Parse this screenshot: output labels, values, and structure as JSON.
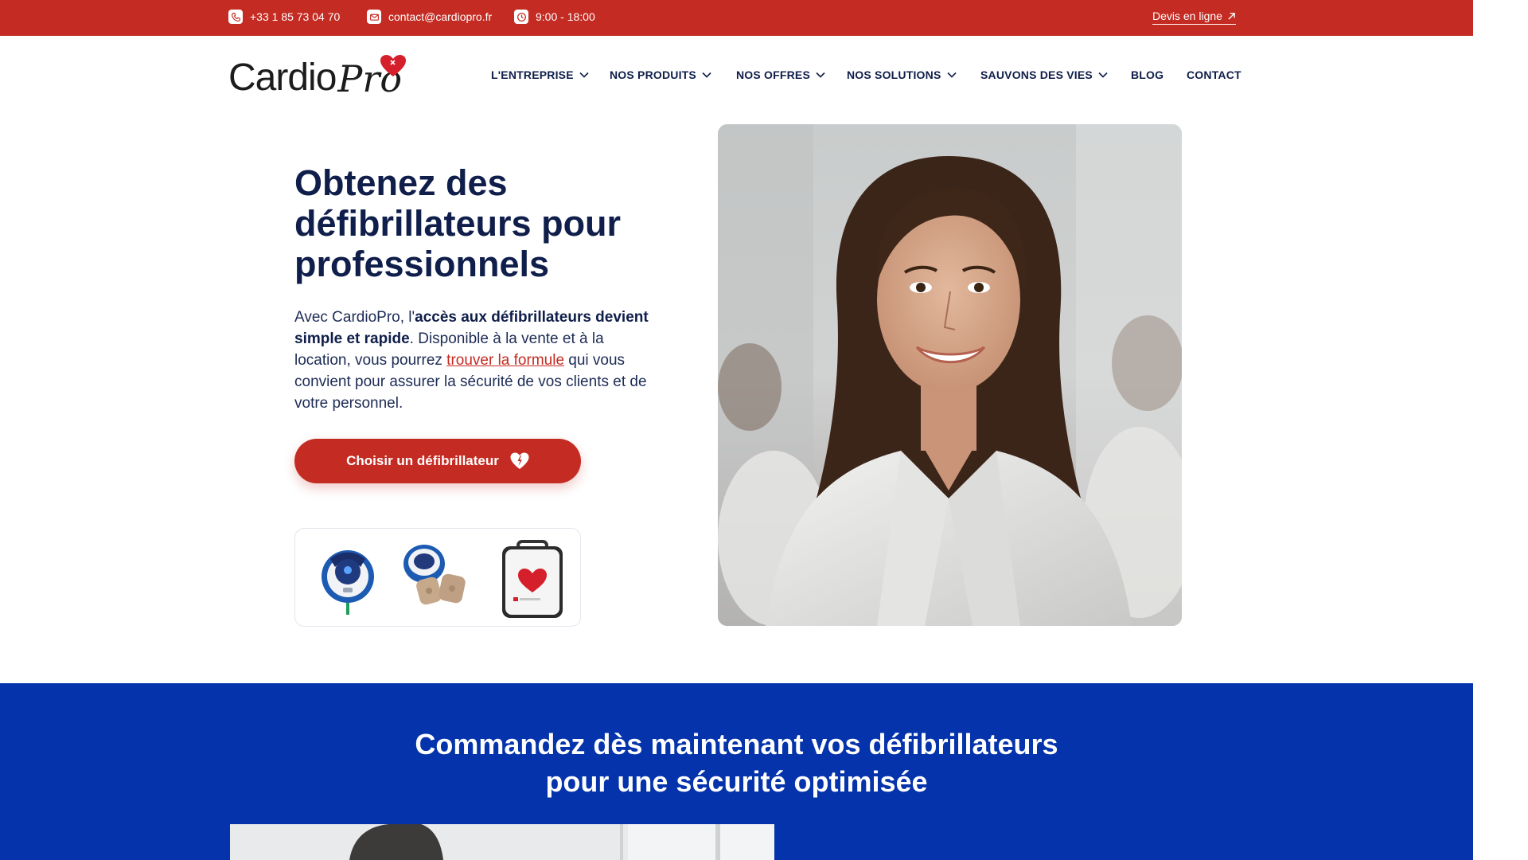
{
  "topbar": {
    "phone": "+33 1 85 73 04 70",
    "email": "contact@cardiopro.fr",
    "hours": "9:00 - 18:00",
    "quote_link": "Devis en ligne",
    "bg_color": "#c42b22"
  },
  "brand": {
    "name_part1": "Cardio",
    "name_part2": "Pro",
    "accent_color": "#c42b22"
  },
  "nav": {
    "items": [
      {
        "label": "L'ENTREPRISE",
        "has_dropdown": true
      },
      {
        "label": "NOS PRODUITS",
        "has_dropdown": true
      },
      {
        "label": "NOS OFFRES",
        "has_dropdown": true
      },
      {
        "label": "NOS SOLUTIONS",
        "has_dropdown": true
      },
      {
        "label": "SAUVONS DES VIES",
        "has_dropdown": true
      },
      {
        "label": "BLOG",
        "has_dropdown": false
      },
      {
        "label": "CONTACT",
        "has_dropdown": false
      }
    ]
  },
  "hero": {
    "title": "Obtenez des défibrillateurs pour professionnels",
    "text_1": "Avec CardioPro, l'",
    "text_bold": "accès aux défibrillateurs devient simple et rapide",
    "text_2": ". Disponible à la vente et à la location, vous pourrez ",
    "text_link": "trouver la formule",
    "text_3": " qui vous convient pour assurer la sécurité de vos clients et de votre personnel.",
    "cta_label": "Choisir un défibrillateur",
    "image_alt": "professional-woman-photo"
  },
  "section2": {
    "title_line1": "Commandez dès maintenant vos défibrillateurs",
    "title_line2": "pour une sécurité optimisée",
    "bg_color": "#0433ab"
  }
}
